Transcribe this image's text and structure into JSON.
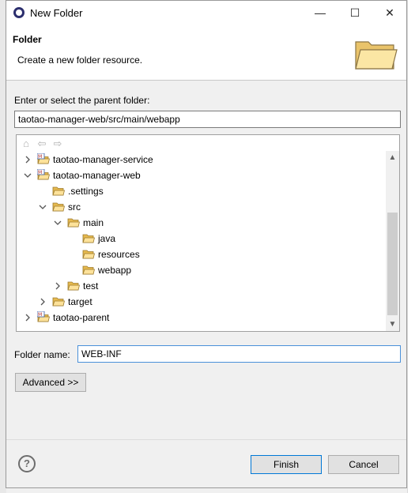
{
  "window": {
    "title": "New Folder",
    "minimize_glyph": "—",
    "maximize_glyph": "☐",
    "close_glyph": "✕"
  },
  "header": {
    "title": "Folder",
    "description": "Create a new folder resource."
  },
  "parent": {
    "label": "Enter or select the parent folder:",
    "value": "taotao-manager-web/src/main/webapp"
  },
  "tree": {
    "toolbar": {
      "home_icon": "home-icon",
      "back_icon": "back-arrow-icon",
      "forward_icon": "forward-arrow-icon"
    },
    "items": [
      {
        "label": "taotao-manager-service",
        "expanded": false,
        "icon": "maven-project-icon",
        "depth": 0
      },
      {
        "label": "taotao-manager-web",
        "expanded": true,
        "icon": "maven-project-icon",
        "depth": 0
      },
      {
        "label": ".settings",
        "expanded": null,
        "icon": "folder-icon",
        "depth": 1
      },
      {
        "label": "src",
        "expanded": true,
        "icon": "folder-icon",
        "depth": 1
      },
      {
        "label": "main",
        "expanded": true,
        "icon": "folder-icon",
        "depth": 2
      },
      {
        "label": "java",
        "expanded": null,
        "icon": "folder-icon",
        "depth": 3
      },
      {
        "label": "resources",
        "expanded": null,
        "icon": "folder-icon",
        "depth": 3
      },
      {
        "label": "webapp",
        "expanded": null,
        "icon": "folder-icon",
        "depth": 3,
        "selected": true
      },
      {
        "label": "test",
        "expanded": false,
        "icon": "folder-icon",
        "depth": 2
      },
      {
        "label": "target",
        "expanded": false,
        "icon": "folder-icon",
        "depth": 1
      },
      {
        "label": "taotao-parent",
        "expanded": false,
        "icon": "maven-project-icon",
        "depth": 0
      }
    ]
  },
  "folder_name": {
    "label": "Folder name:",
    "value": "WEB-INF"
  },
  "buttons": {
    "advanced": "Advanced >>",
    "finish": "Finish",
    "cancel": "Cancel",
    "help": "?"
  }
}
